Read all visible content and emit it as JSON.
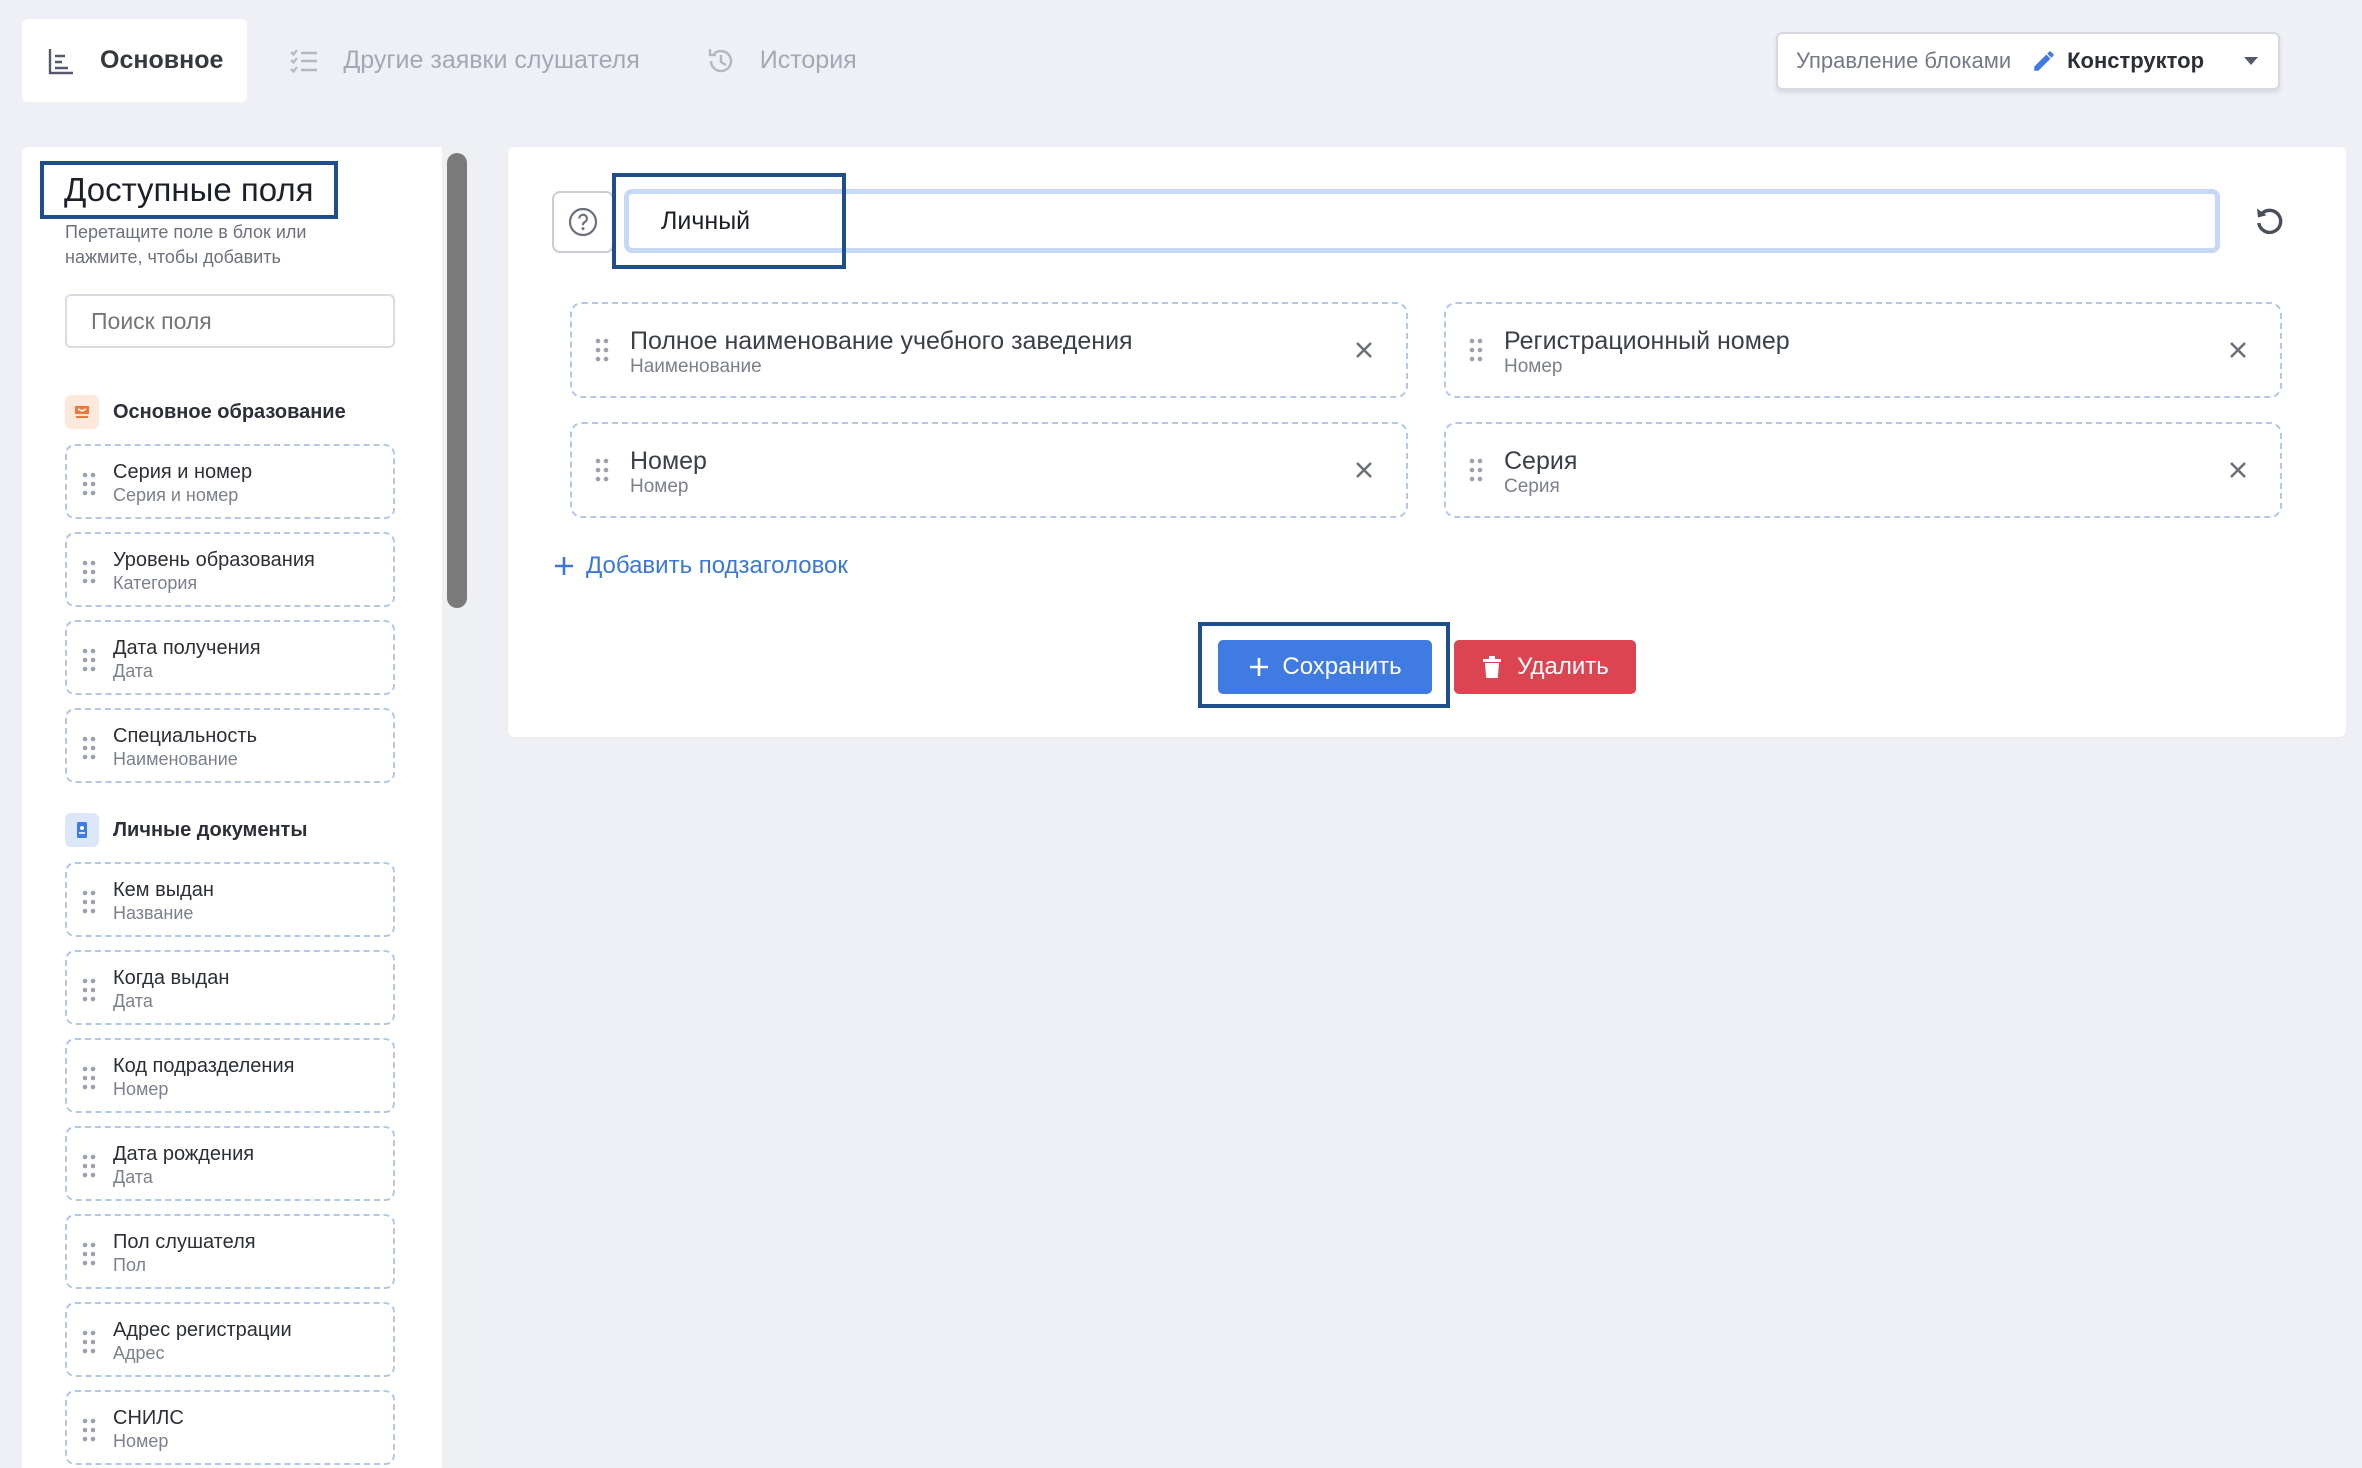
{
  "tabs": [
    {
      "label": "Основное",
      "icon": "bar-list-icon",
      "active": true
    },
    {
      "label": "Другие заявки слушателя",
      "icon": "checklist-icon",
      "active": false
    },
    {
      "label": "История",
      "icon": "history-icon",
      "active": false
    }
  ],
  "block_control": {
    "label": "Управление блоками",
    "mode": "Конструктор"
  },
  "left_panel": {
    "title": "Доступные поля",
    "hint": "Перетащите поле в блок или нажмите, чтобы добавить",
    "search_placeholder": "Поиск поля",
    "groups": [
      {
        "name": "Основное образование",
        "icon": "graduation-cap-icon",
        "color": "#f0763a",
        "fields": [
          {
            "name": "Серия и номер",
            "type": "Серия и номер"
          },
          {
            "name": "Уровень образования",
            "type": "Категория"
          },
          {
            "name": "Дата получения",
            "type": "Дата"
          },
          {
            "name": "Специальность",
            "type": "Наименование"
          }
        ]
      },
      {
        "name": "Личные документы",
        "icon": "id-card-icon",
        "color": "#3f7be0",
        "fields": [
          {
            "name": "Кем выдан",
            "type": "Название"
          },
          {
            "name": "Когда выдан",
            "type": "Дата"
          },
          {
            "name": "Код подразделения",
            "type": "Номер"
          },
          {
            "name": "Дата рождения",
            "type": "Дата"
          },
          {
            "name": "Пол слушателя",
            "type": "Пол"
          },
          {
            "name": "Адрес регистрации",
            "type": "Адрес"
          },
          {
            "name": "СНИЛС",
            "type": "Номер"
          }
        ]
      }
    ]
  },
  "block_editor": {
    "title_value": "Личный",
    "fields": [
      {
        "name": "Полное наименование учебного заведения",
        "type": "Наименование"
      },
      {
        "name": "Регистрационный номер",
        "type": "Номер"
      },
      {
        "name": "Номер",
        "type": "Номер"
      },
      {
        "name": "Серия",
        "type": "Серия"
      }
    ],
    "add_subheading_label": "Добавить подзаголовок",
    "save_label": "Сохранить",
    "delete_label": "Удалить"
  },
  "colors": {
    "accent": "#3f7be0",
    "danger": "#dc4452",
    "highlight": "#1f4e8c"
  }
}
